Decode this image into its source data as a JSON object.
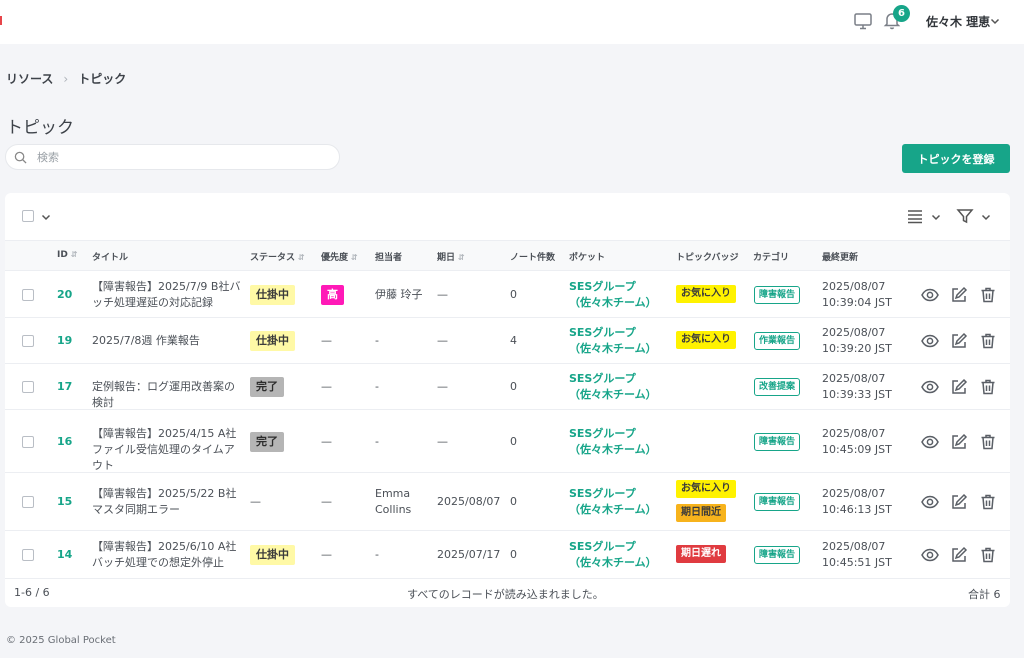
{
  "header": {
    "notification_count": "6",
    "user_name": "佐々木 理恵",
    "icons": [
      "monitor-icon",
      "bell-icon",
      "chevron-down-icon"
    ]
  },
  "breadcrumb": {
    "items": [
      "リソース",
      "トピック"
    ],
    "separator": "›"
  },
  "page_title": "トピック",
  "search": {
    "placeholder": "検索",
    "value": ""
  },
  "create_button": "トピックを登録",
  "table": {
    "columns": {
      "id": "ID",
      "title": "タイトル",
      "status": "ステータス",
      "priority": "優先度",
      "assignee": "担当者",
      "due": "期日",
      "notes": "ノート件数",
      "pocket": "ポケット",
      "badge": "トピックバッジ",
      "category": "カテゴリ",
      "updated": "最終更新"
    },
    "sortable": [
      "ID",
      "ステータス",
      "優先度",
      "期日"
    ],
    "rows": [
      {
        "id": "20",
        "title": "【障害報告】2025/7/9 B社バッチ処理遅延の対応記録",
        "status": "仕掛中",
        "status_kind": "wip",
        "priority": "高",
        "assignee": "伊藤 玲子",
        "due": "—",
        "notes": "0",
        "pocket": "SESグループ（佐々木チーム）",
        "badges": [
          {
            "label": "お気に入り",
            "kind": "fav"
          }
        ],
        "category": "障害報告",
        "updated_date": "2025/08/07",
        "updated_time": "10:39:04 JST"
      },
      {
        "id": "19",
        "title": "2025/7/8週 作業報告",
        "status": "仕掛中",
        "status_kind": "wip",
        "priority": "—",
        "assignee": "-",
        "due": "—",
        "notes": "4",
        "pocket": "SESグループ（佐々木チーム）",
        "badges": [
          {
            "label": "お気に入り",
            "kind": "fav"
          }
        ],
        "category": "作業報告",
        "updated_date": "2025/08/07",
        "updated_time": "10:39:20 JST"
      },
      {
        "id": "17",
        "title": "定例報告：ログ運用改善案の検討",
        "status": "完了",
        "status_kind": "done",
        "priority": "—",
        "assignee": "-",
        "due": "—",
        "notes": "0",
        "pocket": "SESグループ（佐々木チーム）",
        "badges": [],
        "category": "改善提案",
        "updated_date": "2025/08/07",
        "updated_time": "10:39:33 JST"
      },
      {
        "id": "16",
        "title": "【障害報告】2025/4/15 A社ファイル受信処理のタイムアウト",
        "status": "完了",
        "status_kind": "done",
        "priority": "—",
        "assignee": "-",
        "due": "—",
        "notes": "0",
        "pocket": "SESグループ（佐々木チーム）",
        "badges": [],
        "category": "障害報告",
        "updated_date": "2025/08/07",
        "updated_time": "10:45:09 JST"
      },
      {
        "id": "15",
        "title": "【障害報告】2025/5/22 B社マスタ同期エラー",
        "status": "—",
        "status_kind": "none",
        "priority": "—",
        "assignee": "Emma Collins",
        "due": "2025/08/07",
        "notes": "0",
        "pocket": "SESグループ（佐々木チーム）",
        "badges": [
          {
            "label": "お気に入り",
            "kind": "fav"
          },
          {
            "label": "期日間近",
            "kind": "near"
          }
        ],
        "category": "障害報告",
        "updated_date": "2025/08/07",
        "updated_time": "10:46:13 JST"
      },
      {
        "id": "14",
        "title": "【障害報告】2025/6/10 A社バッチ処理での想定外停止",
        "status": "仕掛中",
        "status_kind": "wip",
        "priority": "—",
        "assignee": "-",
        "due": "2025/07/17",
        "notes": "0",
        "pocket": "SESグループ（佐々木チーム）",
        "badges": [
          {
            "label": "期日遅れ",
            "kind": "late"
          }
        ],
        "category": "障害報告",
        "updated_date": "2025/08/07",
        "updated_time": "10:45:51 JST"
      }
    ],
    "row_actions": [
      "eye-icon",
      "edit-icon",
      "trash-icon"
    ]
  },
  "footer": {
    "range": "1-6 / 6",
    "message": "すべてのレコードが読み込まれました。",
    "total": "合計 6"
  },
  "copyright": "© 2025 Global Pocket",
  "colors": {
    "accent": "#17a589",
    "wip": "#fff9a6",
    "done": "#b5b5b5",
    "high": "#ff19b7",
    "fav": "#fff200",
    "near": "#f7b31c",
    "late": "#e03b40"
  }
}
